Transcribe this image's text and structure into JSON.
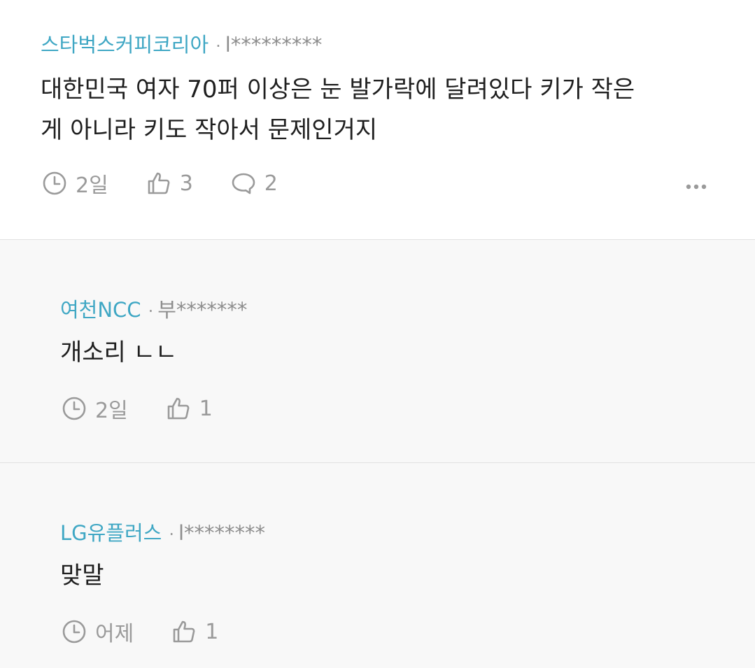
{
  "comments": [
    {
      "author": "스타벅스커피코리아",
      "user": "l*********",
      "text_lines": [
        "대한민국 여자 70퍼 이상은 눈 발가락에 달려있다 키가 작은",
        "게 아니라 키도 작아서 문제인거지"
      ],
      "time": "2일",
      "likes": "3",
      "replies": "2"
    },
    {
      "author": "여천NCC",
      "user": "부*******",
      "text": "개소리 ㄴㄴ",
      "time": "2일",
      "likes": "1"
    },
    {
      "author": "LG유플러스",
      "user": "l********",
      "text": "맞말",
      "time": "어제",
      "likes": "1"
    }
  ],
  "meta": {
    "separator": "·"
  },
  "colors": {
    "author": "#3fa7c4",
    "text": "#1f1f1f",
    "muted": "#9a9a9a",
    "top_bg": "#ffffff",
    "reply_bg": "#f8f8f8"
  }
}
